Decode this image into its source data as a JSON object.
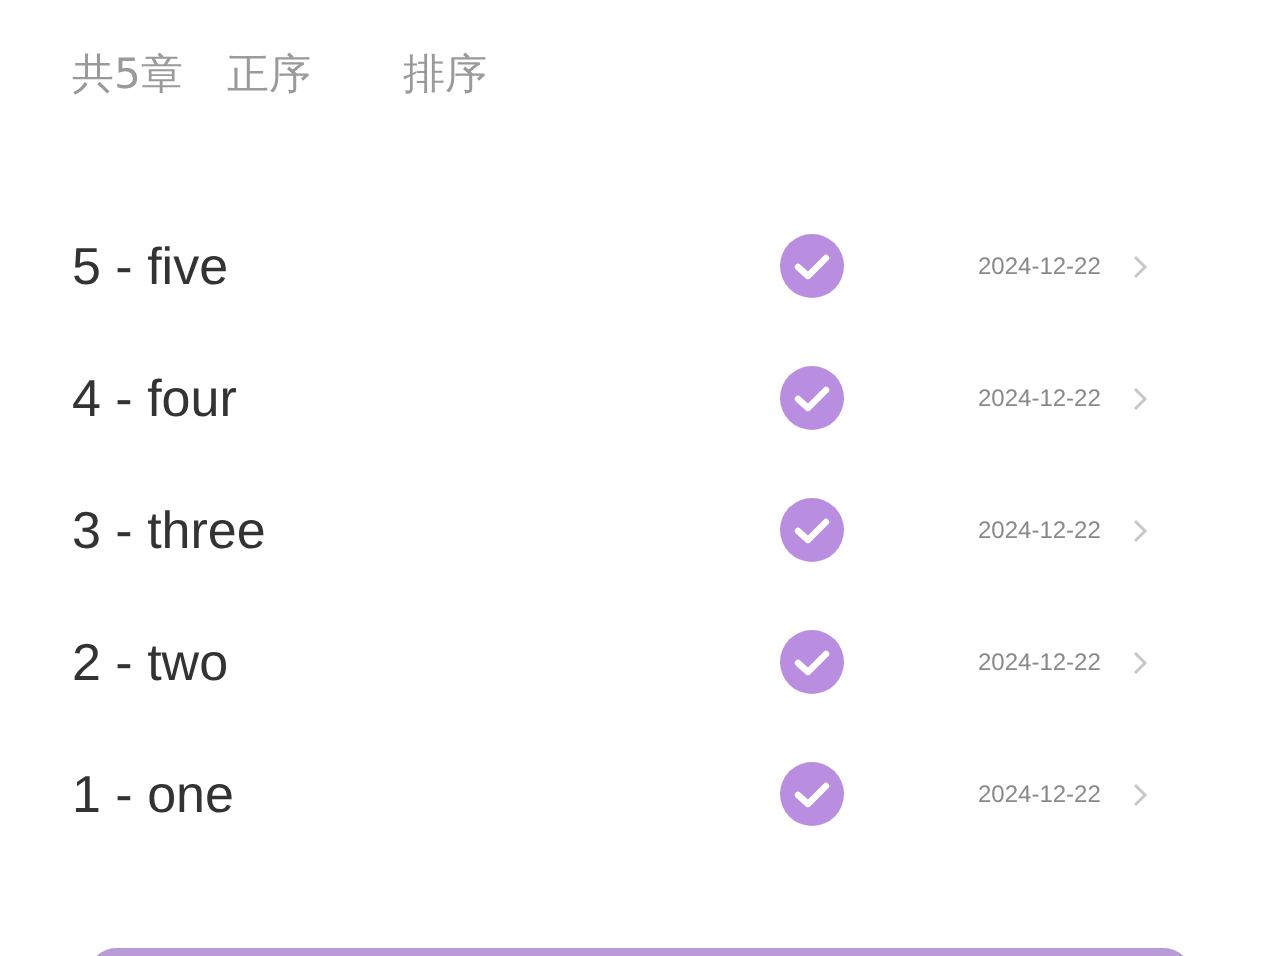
{
  "header": {
    "count": "共5章",
    "order": "正序",
    "sort": "排序"
  },
  "chapters": [
    {
      "title": "5 - five",
      "checked": true,
      "date": "2024-12-22"
    },
    {
      "title": "4 - four",
      "checked": true,
      "date": "2024-12-22"
    },
    {
      "title": "3 - three",
      "checked": true,
      "date": "2024-12-22"
    },
    {
      "title": "2 - two",
      "checked": true,
      "date": "2024-12-22"
    },
    {
      "title": "1 - one",
      "checked": true,
      "date": "2024-12-22"
    }
  ]
}
